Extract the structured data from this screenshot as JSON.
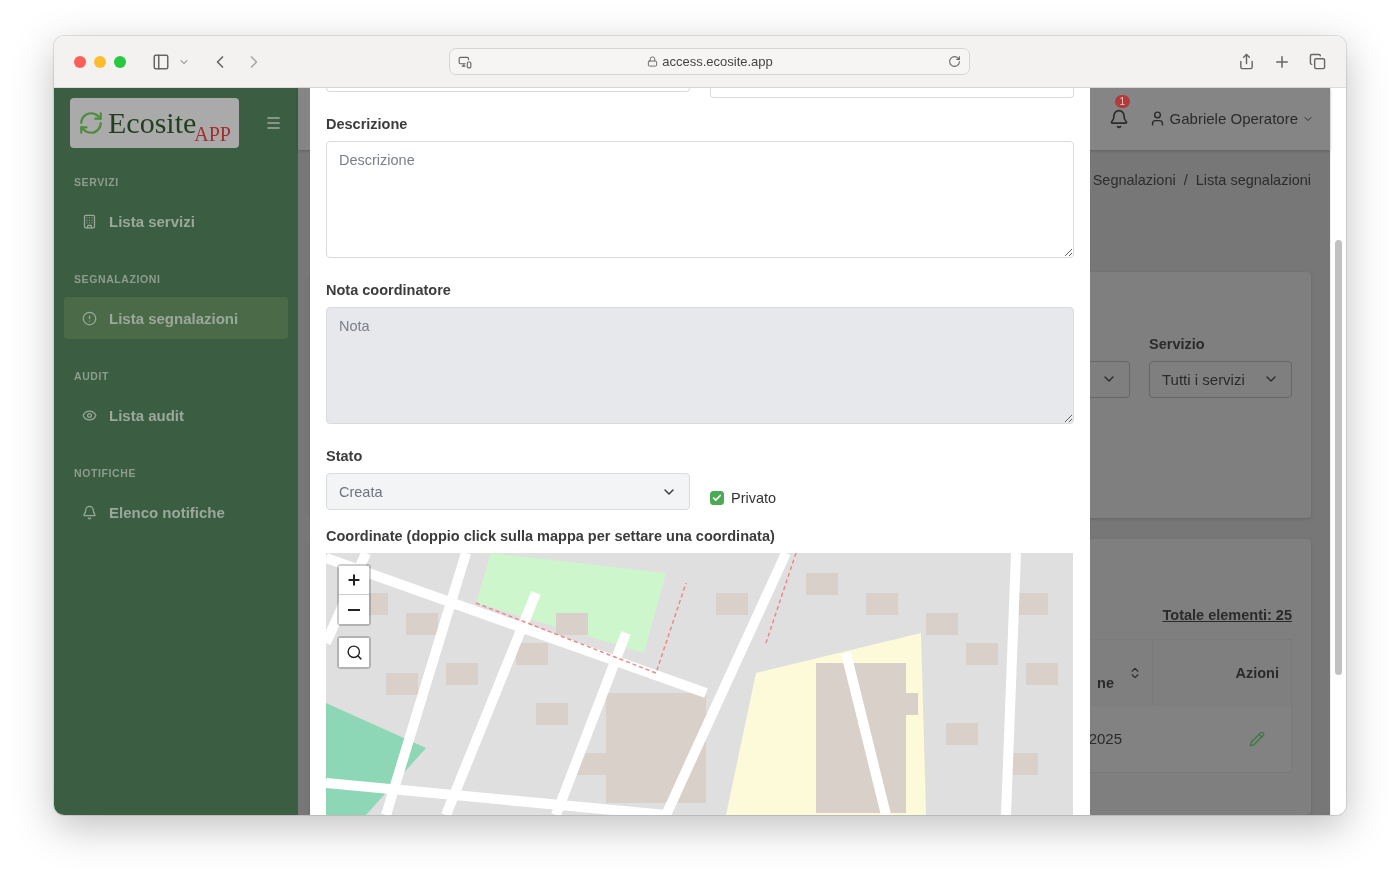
{
  "browser": {
    "url": "access.ecosite.app"
  },
  "sidebar": {
    "logo": {
      "name": "Ecosite",
      "suffix": "APP"
    },
    "sections": [
      {
        "title": "SERVIZI",
        "items": [
          {
            "label": "Lista servizi",
            "selected": false
          }
        ]
      },
      {
        "title": "SEGNALAZIONI",
        "items": [
          {
            "label": "Lista segnalazioni",
            "selected": true
          }
        ]
      },
      {
        "title": "AUDIT",
        "items": [
          {
            "label": "Lista audit",
            "selected": false
          }
        ]
      },
      {
        "title": "NOTIFICHE",
        "items": [
          {
            "label": "Elenco notifiche",
            "selected": false
          }
        ]
      }
    ]
  },
  "header": {
    "notifications": "1",
    "user": "Gabriele Operatore"
  },
  "breadcrumb": {
    "items": [
      "Segnalazioni",
      "Lista segnalazioni"
    ],
    "separator": "/"
  },
  "filters": {
    "service_label": "Servizio",
    "service_value": "Tutti i servizi"
  },
  "table": {
    "total": "Totale elementi: 25",
    "columns": [
      "ne",
      "Azioni"
    ],
    "rows": [
      {
        "cells": [
          "2025"
        ]
      }
    ]
  },
  "modal": {
    "fields": [
      {
        "label": "Descrizione",
        "placeholder": "Descrizione",
        "disabled": false
      },
      {
        "label": "Nota coordinatore",
        "placeholder": "Nota",
        "disabled": true
      }
    ],
    "status": {
      "label": "Stato",
      "value": "Creata",
      "disabled": true
    },
    "private": {
      "label": "Privato",
      "checked": true
    },
    "map": {
      "label": "Coordinate (doppio click sulla mappa per settare una coordinata)"
    }
  }
}
